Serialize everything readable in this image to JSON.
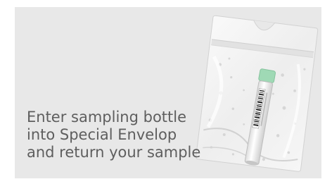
{
  "instruction": {
    "lines": [
      "Enter sampling bottle",
      "into Special Envelop",
      "and return your sample"
    ]
  },
  "illustration": {
    "icon": "sample-bag-with-bottle-icon",
    "cap_color": "#9fd9b5",
    "panel_color": "#e8e8e8"
  }
}
